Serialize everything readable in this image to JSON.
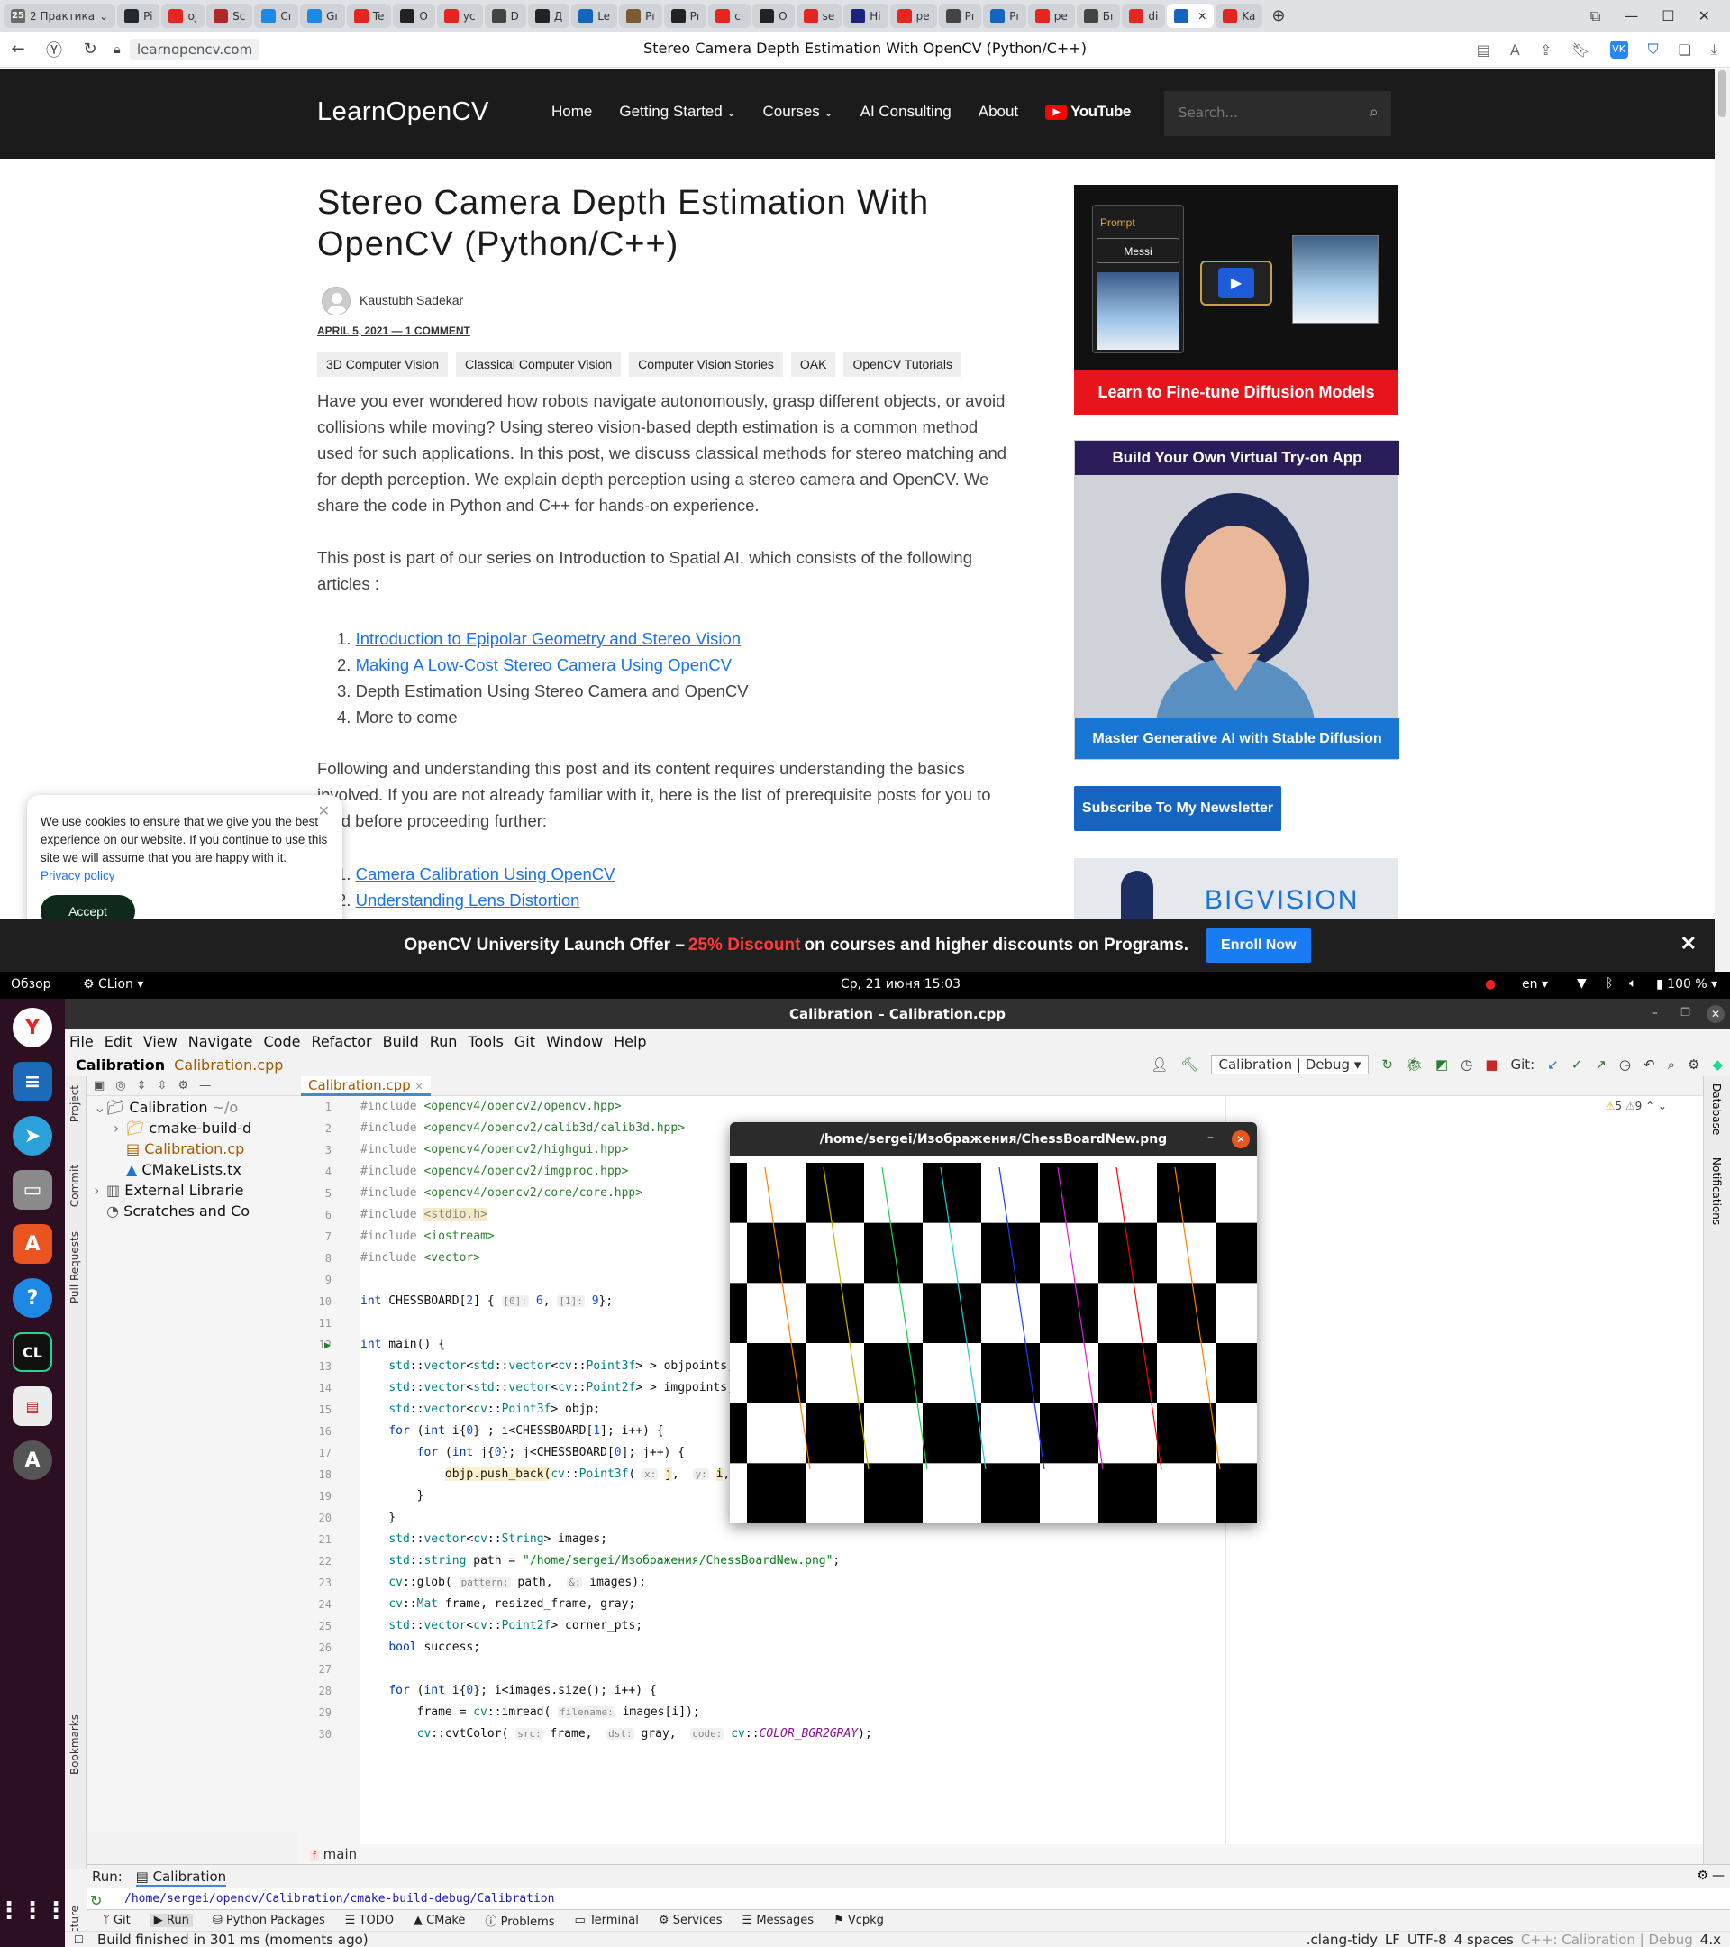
{
  "browser": {
    "tab_count": "25",
    "group_label": "2 Практика",
    "tabs": [
      {
        "label": "Pi",
        "color": "#24292f"
      },
      {
        "label": "oj",
        "color": "#e52620"
      },
      {
        "label": "Sc",
        "color": "#b32626"
      },
      {
        "label": "Cı",
        "color": "#1e88e5"
      },
      {
        "label": "Gı",
        "color": "#1e88e5"
      },
      {
        "label": "Te",
        "color": "#e52620"
      },
      {
        "label": "O",
        "color": "#222222"
      },
      {
        "label": "yc",
        "color": "#e52620"
      },
      {
        "label": "D",
        "color": "#444444"
      },
      {
        "label": "Д",
        "color": "#222222"
      },
      {
        "label": "Le",
        "color": "#1565c0"
      },
      {
        "label": "Pı",
        "color": "#7b5c2e"
      },
      {
        "label": "Pı",
        "color": "#222222"
      },
      {
        "label": "сı",
        "color": "#e52620"
      },
      {
        "label": "O",
        "color": "#222222"
      },
      {
        "label": "se",
        "color": "#e52620"
      },
      {
        "label": "Hi",
        "color": "#1a237e"
      },
      {
        "label": "pe",
        "color": "#e52620"
      },
      {
        "label": "Pı",
        "color": "#444444"
      },
      {
        "label": "Pı",
        "color": "#1565c0"
      },
      {
        "label": "pe",
        "color": "#e52620"
      },
      {
        "label": "Бı",
        "color": "#444444"
      },
      {
        "label": "di",
        "color": "#e52620"
      },
      {
        "label": "",
        "color": "#1565c0"
      },
      {
        "label": "Ka",
        "color": "#e52620"
      }
    ],
    "url": "learnopencv.com",
    "page_title": "Stereo Camera Depth Estimation With OpenCV (Python/C++)"
  },
  "site": {
    "logo": "LearnOpenCV",
    "nav": [
      "Home",
      "Getting Started",
      "Courses",
      "AI Consulting",
      "About"
    ],
    "youtube": "YouTube",
    "search_placeholder": "Search..."
  },
  "article": {
    "title": "Stereo Camera Depth Estimation With OpenCV (Python/C++)",
    "author": "Kaustubh Sadekar",
    "date": "APRIL 5, 2021",
    "comments": "1 COMMENT",
    "tags": [
      "3D Computer Vision",
      "Classical Computer Vision",
      "Computer Vision Stories",
      "OAK",
      "OpenCV Tutorials"
    ],
    "p1": "Have you ever wondered how robots navigate autonomously, grasp different objects, or avoid collisions while moving? Using stereo vision-based depth estimation is a common method used for such applications. In this post, we discuss classical methods for stereo matching and for depth perception. We explain depth perception using a stereo camera and OpenCV. We share the code in Python and C++ for hands-on experience.",
    "p2": "This post is part of our series on Introduction to Spatial AI, which consists of the following articles :",
    "series": [
      "Introduction to Epipolar Geometry and Stereo Vision",
      "Making A Low-Cost Stereo Camera Using OpenCV",
      "Depth Estimation Using Stereo Camera and OpenCV",
      "More to come"
    ],
    "p3": "Following and understanding this post and its content requires understanding the basics involved. If you are not already familiar with it, here  is the list of prerequisite posts for you to read before proceeding further:",
    "prereq": [
      "Camera Calibration Using OpenCV",
      "Understanding Lens Distortion"
    ]
  },
  "sidebar": {
    "ad1_prompt": "Prompt",
    "ad1_name": "Messi",
    "ad1_button": "Learn to Fine-tune Diffusion Models",
    "ad2_head": "Build Your Own Virtual Try-on App",
    "ad2_button": "Master Generative AI with Stable Diffusion",
    "subscribe": "Subscribe To My Newsletter",
    "ad3_logo": "BIGVISION"
  },
  "cookie": {
    "text": "We use cookies to ensure that we give you the best experience on our website. If you continue to use this site we will assume that you are happy with it.",
    "link": "Privacy policy",
    "accept": "Accept"
  },
  "promo": {
    "pre": "OpenCV University Launch Offer –",
    "discount": "25% Discount",
    "post": "on courses and higher discounts on Programs.",
    "button": "Enroll Now"
  },
  "gnome": {
    "overview": "Обзор",
    "app": "CLion",
    "clock": "Ср, 21 июня  15:03",
    "lang": "en",
    "battery": "100 %"
  },
  "clion": {
    "title": "Calibration – Calibration.cpp",
    "menu": [
      "File",
      "Edit",
      "View",
      "Navigate",
      "Code",
      "Refactor",
      "Build",
      "Run",
      "Tools",
      "Git",
      "Window",
      "Help"
    ],
    "project": "Calibration",
    "file": "Calibration.cpp",
    "run_config": "Calibration | Debug",
    "git": "Git:",
    "tree": [
      {
        "label": "Calibration",
        "suffix": "~/o",
        "depth": 0
      },
      {
        "label": "cmake-build-d",
        "suffix": "",
        "depth": 1
      },
      {
        "label": "Calibration.cp",
        "suffix": "",
        "depth": 1
      },
      {
        "label": "CMakeLists.tx",
        "suffix": "",
        "depth": 1
      },
      {
        "label": "External Librarie",
        "suffix": "",
        "depth": 0
      },
      {
        "label": "Scratches and Co",
        "suffix": "",
        "depth": 0
      }
    ],
    "left_tools": [
      "Project",
      "Commit",
      "Pull Requests",
      "Bookmarks",
      "Structure"
    ],
    "right_tools": [
      "Database",
      "Notifications"
    ],
    "warnings": "5",
    "weak_warnings": "9",
    "breadcrumb": "main",
    "run_label": "Run:",
    "run_tab": "Calibration",
    "run_path": "/home/sergei/opencv/Calibration/cmake-build-debug/Calibration",
    "bottom_tabs": [
      "Git",
      "Run",
      "Python Packages",
      "TODO",
      "CMake",
      "Problems",
      "Terminal",
      "Services",
      "Messages",
      "Vcpkg"
    ],
    "status": "Build finished in 301 ms (moments ago)",
    "status_right": [
      ".clang-tidy",
      "LF",
      "UTF-8",
      "4 spaces",
      "C++: Calibration | Debug",
      "4.x"
    ]
  },
  "image_window": {
    "title": "/home/sergei/Изображения/ChessBoardNew.png"
  }
}
